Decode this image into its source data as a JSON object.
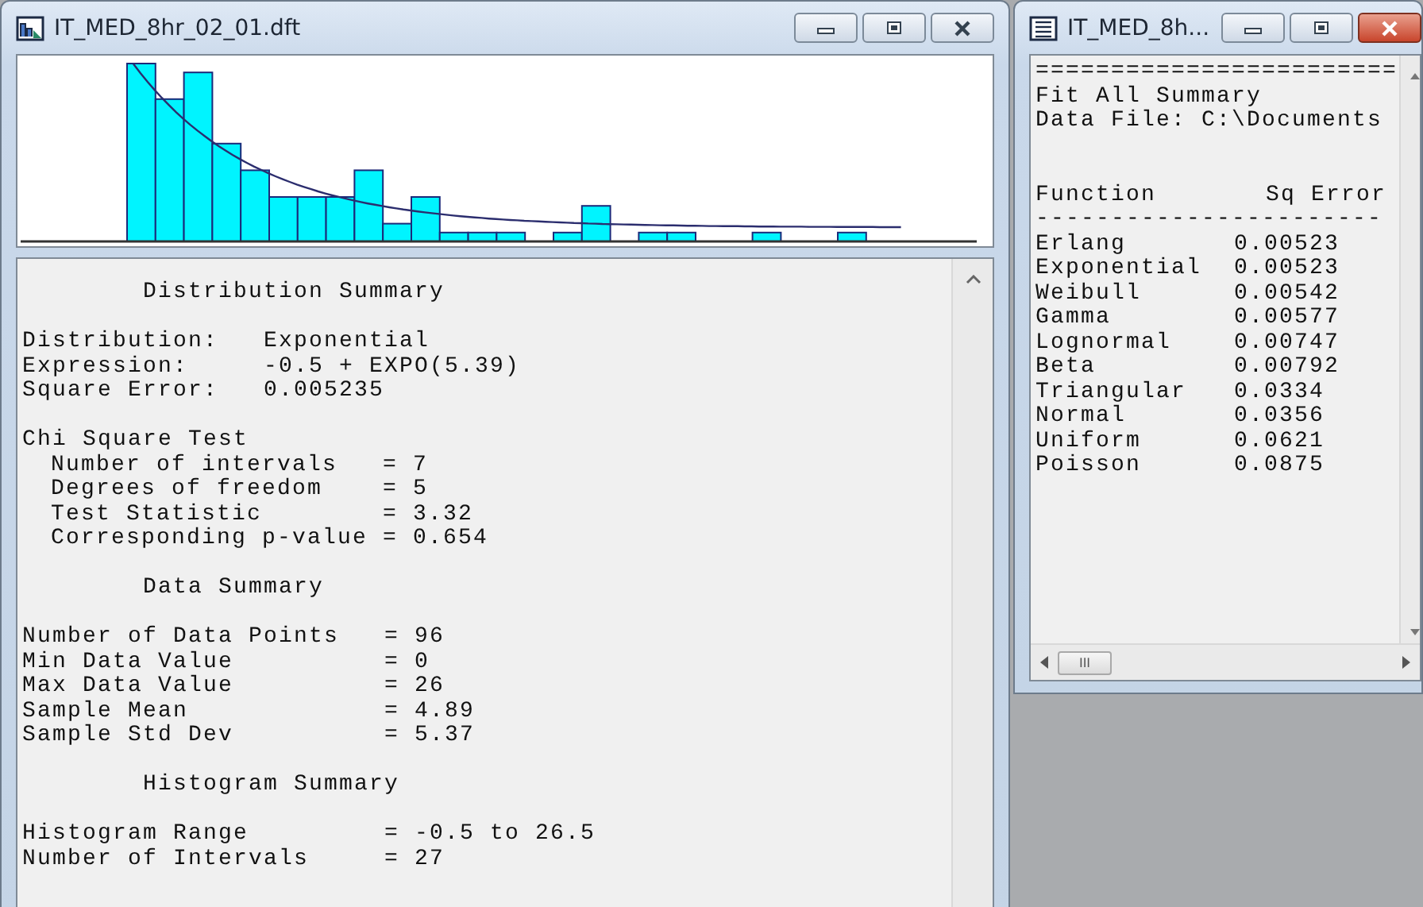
{
  "histogram_window": {
    "title": "IT_MED_8hr_02_01.dft",
    "active": false,
    "report": [
      [
        {
          "kind": "heading",
          "text": "Distribution Summary"
        }
      ],
      [
        {
          "kind": "line",
          "text": "Distribution:   Exponential"
        },
        {
          "kind": "line",
          "text": "Expression:     -0.5 + EXPO(5.39)"
        },
        {
          "kind": "line",
          "text": "Square Error:   0.005235"
        }
      ],
      [
        {
          "kind": "line",
          "text": "Chi Square Test"
        },
        {
          "kind": "sub",
          "text": "Number of intervals   = 7"
        },
        {
          "kind": "sub",
          "text": "Degrees of freedom    = 5"
        },
        {
          "kind": "sub",
          "text": "Test Statistic        = 3.32"
        },
        {
          "kind": "sub",
          "text": "Corresponding p-value = 0.654"
        }
      ],
      [
        {
          "kind": "heading",
          "text": "Data Summary"
        }
      ],
      [
        {
          "kind": "line",
          "text": "Number of Data Points   = 96"
        },
        {
          "kind": "line",
          "text": "Min Data Value          = 0"
        },
        {
          "kind": "line",
          "text": "Max Data Value          = 26"
        },
        {
          "kind": "line",
          "text": "Sample Mean             = 4.89"
        },
        {
          "kind": "line",
          "text": "Sample Std Dev          = 5.37"
        }
      ],
      [
        {
          "kind": "heading",
          "text": "Histogram Summary"
        }
      ],
      [
        {
          "kind": "line",
          "text": "Histogram Range         = -0.5 to 26.5"
        },
        {
          "kind": "line",
          "text": "Number of Intervals     = 27"
        }
      ]
    ]
  },
  "summary_window": {
    "title": "IT_MED_8h...",
    "active": true,
    "header_lines": [
      "========================",
      "Fit All Summary",
      "Data File: C:\\Documents"
    ],
    "columns": [
      "Function",
      "Sq Error"
    ],
    "rule": "-----------------------",
    "rows": [
      {
        "function": "Erlang",
        "sq_error": "0.00523"
      },
      {
        "function": "Exponential",
        "sq_error": "0.00523"
      },
      {
        "function": "Weibull",
        "sq_error": "0.00542"
      },
      {
        "function": "Gamma",
        "sq_error": "0.00577"
      },
      {
        "function": "Lognormal",
        "sq_error": "0.00747"
      },
      {
        "function": "Beta",
        "sq_error": "0.00792"
      },
      {
        "function": "Triangular",
        "sq_error": "0.0334"
      },
      {
        "function": "Normal",
        "sq_error": "0.0356"
      },
      {
        "function": "Uniform",
        "sq_error": "0.0621"
      },
      {
        "function": "Poisson",
        "sq_error": "0.0875"
      }
    ],
    "scroll_thumb": "III"
  }
}
